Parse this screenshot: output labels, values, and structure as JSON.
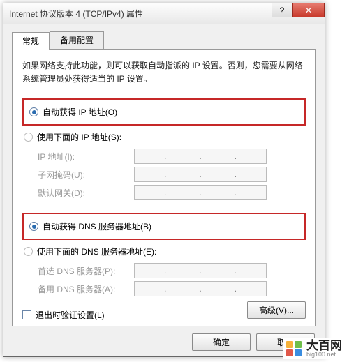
{
  "window": {
    "title": "Internet 协议版本 4 (TCP/IPv4) 属性"
  },
  "tabs": {
    "general": "常规",
    "alternate": "备用配置"
  },
  "intro": "如果网络支持此功能，则可以获取自动指派的 IP 设置。否则，您需要从网络系统管理员处获得适当的 IP 设置。",
  "ip": {
    "auto": "自动获得 IP 地址(O)",
    "manual": "使用下面的 IP 地址(S):",
    "addr_label": "IP 地址(I):",
    "mask_label": "子网掩码(U):",
    "gw_label": "默认网关(D):"
  },
  "dns": {
    "auto": "自动获得 DNS 服务器地址(B)",
    "manual": "使用下面的 DNS 服务器地址(E):",
    "pref_label": "首选 DNS 服务器(P):",
    "alt_label": "备用 DNS 服务器(A):"
  },
  "validate": "退出时验证设置(L)",
  "buttons": {
    "advanced": "高级(V)...",
    "ok": "确定",
    "cancel": "取消"
  },
  "watermark": {
    "name": "大百网",
    "domain": "big100.net"
  },
  "colors": {
    "highlight": "#c62828"
  }
}
